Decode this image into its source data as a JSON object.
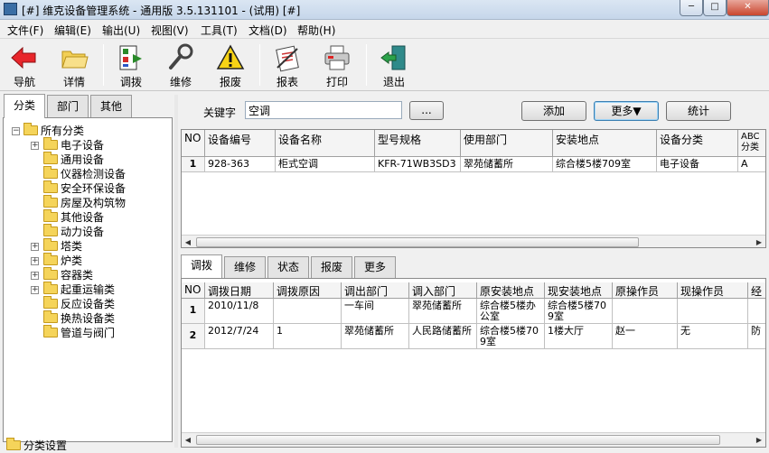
{
  "window": {
    "title": "[#] 维克设备管理系统 - 通用版 3.5.131101 - (试用) [#]",
    "min": "─",
    "max": "□",
    "close": "✕"
  },
  "menu": [
    "文件(F)",
    "编辑(E)",
    "输出(U)",
    "视图(V)",
    "工具(T)",
    "文档(D)",
    "帮助(H)"
  ],
  "toolbar": [
    {
      "label": "导航",
      "icon": "back-arrow-icon"
    },
    {
      "label": "详情",
      "icon": "folder-open-icon"
    },
    {
      "label": "调拨",
      "icon": "transfer-icon"
    },
    {
      "label": "维修",
      "icon": "wrench-icon"
    },
    {
      "label": "报废",
      "icon": "warning-icon"
    },
    {
      "label": "报表",
      "icon": "report-icon"
    },
    {
      "label": "打印",
      "icon": "printer-icon"
    },
    {
      "label": "退出",
      "icon": "exit-door-icon"
    }
  ],
  "left_tabs": [
    "分类",
    "部门",
    "其他"
  ],
  "tree": {
    "root": "所有分类",
    "items": [
      "电子设备",
      "通用设备",
      "仪器检测设备",
      "安全环保设备",
      "房屋及构筑物",
      "其他设备",
      "动力设备",
      "塔类",
      "炉类",
      "容器类",
      "起重运输类",
      "反应设备类",
      "换热设备类",
      "管道与阀门"
    ]
  },
  "bottom_left": "分类设置",
  "search": {
    "label": "关键字",
    "value": "空调",
    "browse": "..."
  },
  "buttons": {
    "add": "添加",
    "more": "更多▼",
    "stats": "统计"
  },
  "grid1": {
    "headers": [
      "NO",
      "设备编号",
      "设备名称",
      "型号规格",
      "使用部门",
      "安装地点",
      "设备分类",
      "ABC分类"
    ],
    "rows": [
      [
        "1",
        "928-363",
        "柜式空调",
        "KFR-71WB3SD3",
        "翠苑储蓄所",
        "综合楼5楼709室",
        "电子设备",
        "A"
      ]
    ]
  },
  "detail_tabs": [
    "调拨",
    "维修",
    "状态",
    "报废",
    "更多"
  ],
  "grid2": {
    "headers": [
      "NO",
      "调拨日期",
      "调拨原因",
      "调出部门",
      "调入部门",
      "原安装地点",
      "现安装地点",
      "原操作员",
      "现操作员",
      "经"
    ],
    "rows": [
      [
        "1",
        "2010/11/8",
        "",
        "一车间",
        "翠苑储蓄所",
        "综合楼5楼办公室",
        "综合楼5楼709室",
        "",
        "",
        ""
      ],
      [
        "2",
        "2012/7/24",
        "1",
        "翠苑储蓄所",
        "人民路储蓄所",
        "综合楼5楼709室",
        "1楼大厅",
        "赵一",
        "无",
        "防"
      ]
    ]
  },
  "scroll": {
    "left": "◀",
    "right": "▶"
  },
  "colors": {
    "folder": "#f5d45a",
    "accent": "#3c7fb1"
  }
}
